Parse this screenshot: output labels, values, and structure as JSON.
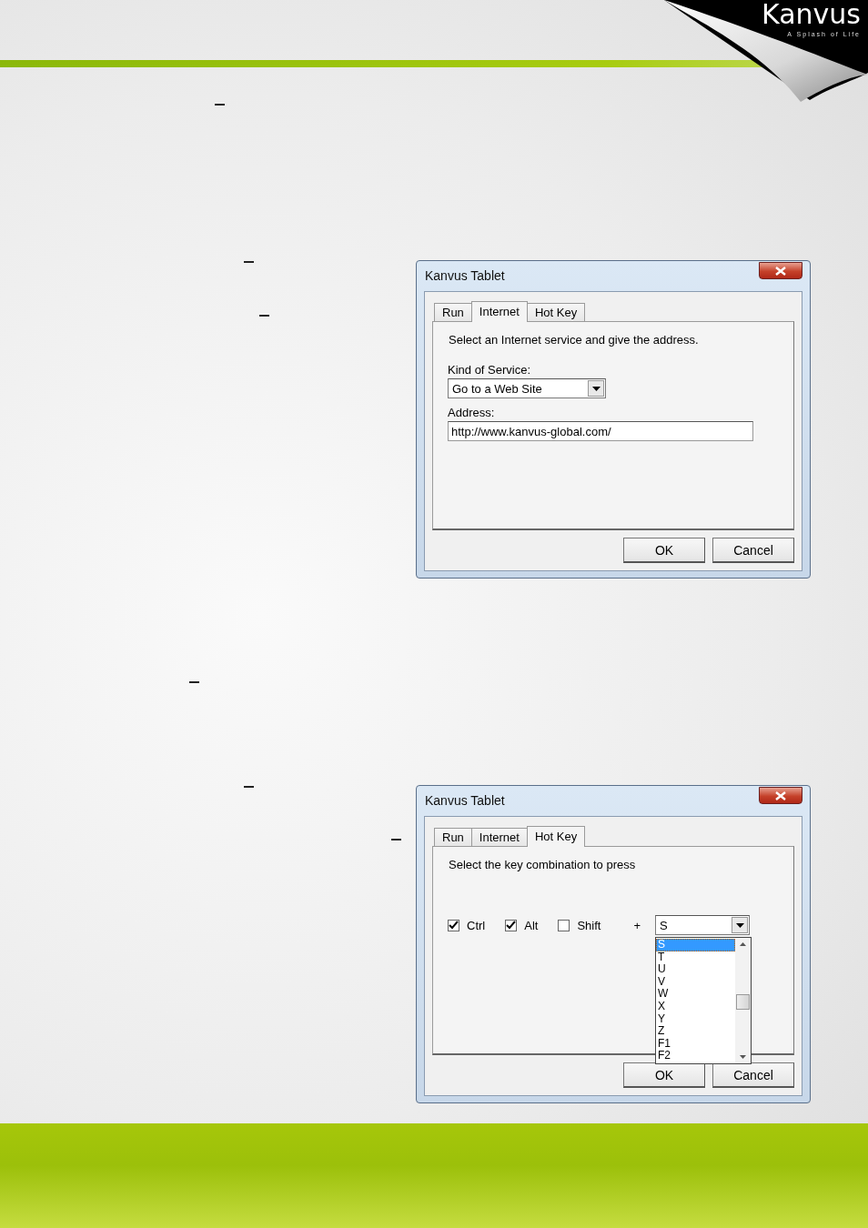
{
  "logo": {
    "name": "Kanvus",
    "tagline": "A Splash of Life"
  },
  "dialogs": [
    {
      "kind": "internet",
      "title": "Kanvus Tablet",
      "tabs": [
        {
          "label": "Run",
          "selected": false
        },
        {
          "label": "Internet",
          "selected": true
        },
        {
          "label": "Hot Key",
          "selected": false
        }
      ],
      "instruction": "Select an Internet service and give the address.",
      "service_label": "Kind of Service:",
      "service_value": "Go to a Web Site",
      "address_label": "Address:",
      "address_value": "http://www.kanvus-global.com/",
      "buttons": [
        "OK",
        "Cancel"
      ]
    },
    {
      "kind": "hotkey",
      "title": "Kanvus Tablet",
      "tabs": [
        {
          "label": "Run",
          "selected": false
        },
        {
          "label": "Internet",
          "selected": false
        },
        {
          "label": "Hot Key",
          "selected": true
        }
      ],
      "instruction": "Select the key combination to press",
      "modifiers": [
        {
          "label": "Ctrl",
          "checked": true
        },
        {
          "label": "Alt",
          "checked": true
        },
        {
          "label": "Shift",
          "checked": false
        }
      ],
      "plus": "+",
      "key_value": "S",
      "key_list": {
        "expanded": true,
        "items": [
          {
            "label": "S",
            "selected": true
          },
          {
            "label": "T",
            "selected": false
          },
          {
            "label": "U",
            "selected": false
          },
          {
            "label": "V",
            "selected": false
          },
          {
            "label": "W",
            "selected": false
          },
          {
            "label": "X",
            "selected": false
          },
          {
            "label": "Y",
            "selected": false
          },
          {
            "label": "Z",
            "selected": false
          },
          {
            "label": "F1",
            "selected": false
          },
          {
            "label": "F2",
            "selected": false
          }
        ]
      },
      "buttons": [
        "OK",
        "Cancel"
      ]
    }
  ]
}
